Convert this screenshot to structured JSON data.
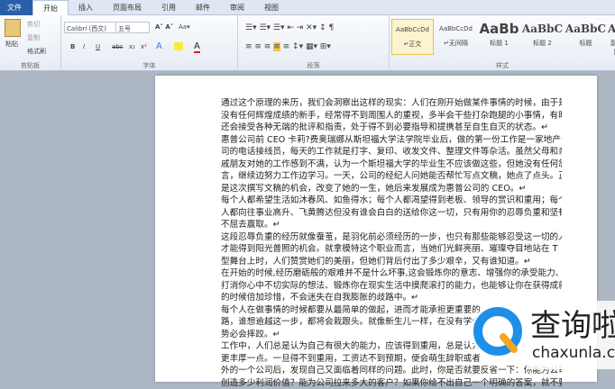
{
  "tabs": [
    "文件",
    "开始",
    "插入",
    "页面布局",
    "引用",
    "邮件",
    "审阅",
    "视图"
  ],
  "clipboard": {
    "paste": "粘贴",
    "cut": "剪切",
    "copy": "复制",
    "format_painter": "格式刷",
    "label": "剪贴板"
  },
  "font": {
    "name": "Calibri (西文)",
    "size": "五号",
    "label": "字体",
    "bold": "B",
    "italic": "I",
    "underline": "U",
    "strike": "abc",
    "sub": "x₂",
    "sup": "x²"
  },
  "paragraph": {
    "label": "段落"
  },
  "styles": {
    "label": "样式",
    "items": [
      {
        "preview": "AaBbCcDd",
        "name": "↵正文"
      },
      {
        "preview": "AaBbCcDd",
        "name": "↵无间隔"
      },
      {
        "preview": "AaBb",
        "name": "标题 1"
      },
      {
        "preview": "AaBbC",
        "name": "标题 2"
      },
      {
        "preview": "AaBbC",
        "name": "标题"
      },
      {
        "preview": "AaB",
        "name": "副标题"
      }
    ]
  },
  "document": {
    "lines": [
      "通过这个原理的来历，我们会洞察出这样的现实：人们在刚开始做某件事情的时候，由于是",
      "没有任何辉煌成绩的新手，经常得不到周围人的重视，多半会干些打杂跑腿的小事情，有时",
      "还会接受各种无端的批评和指责，处于得不到必要指导和提携甚至自生自灭的状态。↵",
      "惠普公司前 CEO 卡莉?费奥瑞娜从斯坦福大学法学院毕业后，做的第一份工作是一家地产公",
      "司的电话接线员，每天的工作就是打字、复印、收发文件、整理文件等杂活。虽然父母和亲",
      "戚朋友对她的工作感到不满，认为一个斯坦福大学的毕业生不应该做这些，但她没有任何怨",
      "言，继续边努力工作边学习。一天，公司的经纪人问她能否帮忙写点文稿，她点了点头。正",
      "是这次撰写文稿的机会，改变了她的一生，她后来发展成为惠普公司的 CEO。↵",
      "每个人都希望生活如沐春风、如鱼得水；每个人都渴望得到老板、领导的赏识和重用；每个",
      "人都向往事业高升、飞黄腾达但没有谁会白白的送给你这一切，只有用你的忍辱负重和坚韧",
      "不屈去赢取。↵",
      "这段忍辱负重的经历就像蚕茧，是羽化前必须经历的一步，也只有那些能够忍受这一切的人",
      "才能得到阳光普照的机会。就拿模特这个职业而言，当她们光鲜亮丽、璀璨夺目地站在 T",
      "型舞台上时，人们赞赏她们的美丽，但她们背后付出了多少艰辛，又有谁知道。↵",
      "在开始的时候,经历磨砺般的艰难并不是什么坏事,这会锻炼你的意志、增强你的承受能力、",
      "打消你心中不切实际的想法、锻炼你在现实生活中摸爬滚打的能力，也能够让你在获得成就",
      "的时候倍加珍惜，不会迷失在自我膨胀的歧路中。↵",
      "每个人在做事情的时候都要从最简单的做起，进而才能承担更重要的",
      "路，谁想逾越这一步，都将会栽跟头。就像新生儿一样，在没有学会",
      "势必会摔跤。↵",
      "工作中，人们总是认为自己有很大的能力，应该得到重用，总是认为",
      "更丰厚一点。一旦得不到重用，工资达不到预期，便会萌生辞职或者",
      "外的一个公司后，发现自己又面临着同样的问题。此时，你是否就要反省一下：你能为公司",
      "创造多少利润价值？能为公司拉来多大的客户？如果你给不出自己一个明确的答案，就不要"
    ]
  },
  "watermark": {
    "cn": "查询啦",
    "en": "chaxunla.com"
  }
}
